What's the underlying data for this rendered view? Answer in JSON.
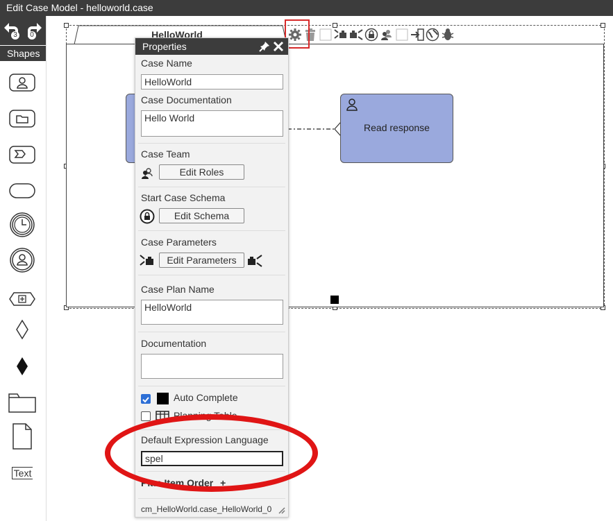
{
  "window": {
    "title": "Edit Case Model - helloworld.case"
  },
  "undo": {
    "undo_count": "3",
    "redo_count": "0"
  },
  "toolbox": {
    "header": "Shapes",
    "items": [
      "human-task-icon",
      "case-task-icon",
      "process-task-icon",
      "stage-milestone-icon",
      "timer-event-icon",
      "user-event-icon",
      "plan-fragment-icon",
      "entry-criterion-icon",
      "exit-criterion-icon",
      "case-file-item-icon",
      "document-icon",
      "text-annotation-icon"
    ],
    "text_tool_label": "Text"
  },
  "canvas": {
    "case_plan_name": "HelloWorld",
    "tasks": [
      {
        "label": "Read response"
      }
    ]
  },
  "properties": {
    "title": "Properties",
    "case_name_label": "Case Name",
    "case_name_value": "HelloWorld",
    "case_doc_label": "Case Documentation",
    "case_doc_value": "Hello World",
    "case_team_label": "Case Team",
    "edit_roles": "Edit Roles",
    "start_schema_label": "Start Case Schema",
    "edit_schema": "Edit Schema",
    "case_params_label": "Case Parameters",
    "edit_params": "Edit Parameters",
    "case_plan_name_label": "Case Plan Name",
    "case_plan_name_value": "HelloWorld",
    "documentation_label": "Documentation",
    "documentation_value": "",
    "auto_complete_label": "Auto Complete",
    "auto_complete_checked": true,
    "planning_table_label": "Planning Table",
    "planning_table_checked": false,
    "default_expr_lang_label": "Default Expression Language",
    "default_expr_lang_value": "spel",
    "plan_item_order_label": "Plan Item Order",
    "plan_item_order_add": "+",
    "footer_id": "cm_HelloWorld.case_HelloWorld_0"
  },
  "highlight_color": "#e01515",
  "task_color": "#9aa9dd"
}
